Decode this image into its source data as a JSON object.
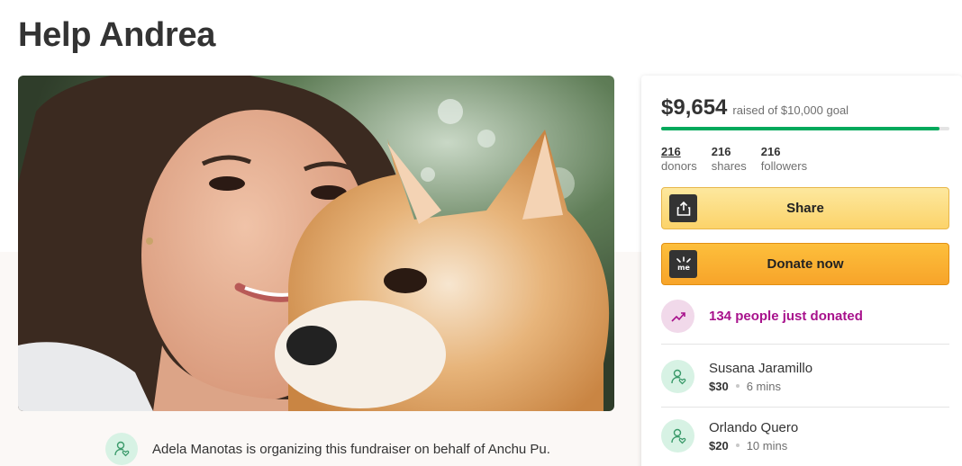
{
  "page": {
    "title": "Help Andrea"
  },
  "organizer": {
    "text": "Adela Manotas is organizing this fundraiser on behalf of Anchu Pu."
  },
  "summary": {
    "raised": "$9,654",
    "raised_label": "raised of $10,000 goal",
    "progress_fraction": 0.9654,
    "stats": [
      {
        "number": "216",
        "label": "donors"
      },
      {
        "number": "216",
        "label": "shares"
      },
      {
        "number": "216",
        "label": "followers"
      }
    ]
  },
  "buttons": {
    "share_label": "Share",
    "donate_label": "Donate now"
  },
  "activity": {
    "just_donated": "134 people just donated"
  },
  "donations": [
    {
      "name": "Susana Jaramillo",
      "amount": "$30",
      "time": "6 mins"
    },
    {
      "name": "Orlando Quero",
      "amount": "$20",
      "time": "10 mins"
    }
  ],
  "colors": {
    "accent_green": "#02a95c",
    "highlight_magenta": "#a8128c",
    "share_button": "#fcd36a",
    "donate_button": "#f7a42a"
  }
}
